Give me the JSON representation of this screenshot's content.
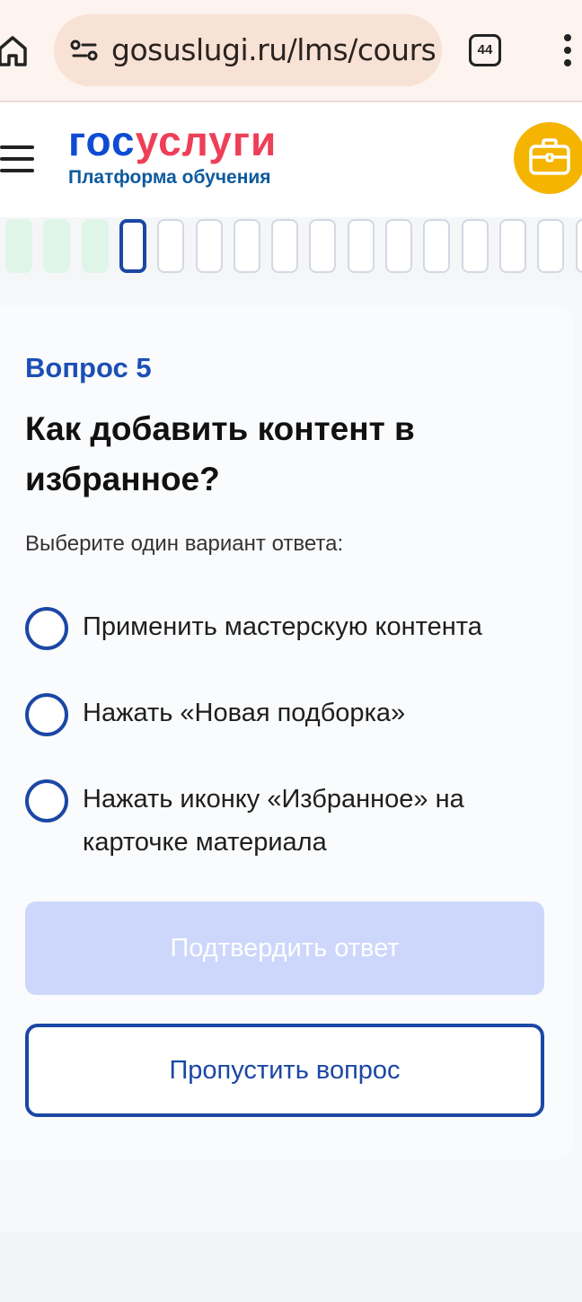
{
  "browser": {
    "url": "gosuslugi.ru/lms/courses",
    "tab_count": "44"
  },
  "header": {
    "logo_part1": "гос",
    "logo_part2": "услуги",
    "subtitle": "Платформа обучения"
  },
  "progress": {
    "done_count": 3,
    "current_index": 3,
    "total_visible": 16
  },
  "question": {
    "number_label": "Вопрос 5",
    "title": "Как добавить контент в избранное?",
    "instruction": "Выберите один вариант ответа:",
    "options": [
      {
        "label": "Применить мастерскую контента"
      },
      {
        "label": "Нажать «Новая подборка»"
      },
      {
        "label": "Нажать иконку «Избранное» на карточке материала"
      }
    ],
    "confirm_label": "Подтвердить ответ",
    "skip_label": "Пропустить вопрос"
  },
  "colors": {
    "brand_blue": "#0d4cd3",
    "brand_red": "#ee3f58",
    "accent_yellow": "#f4b400",
    "radio_blue": "#1b47a5"
  }
}
